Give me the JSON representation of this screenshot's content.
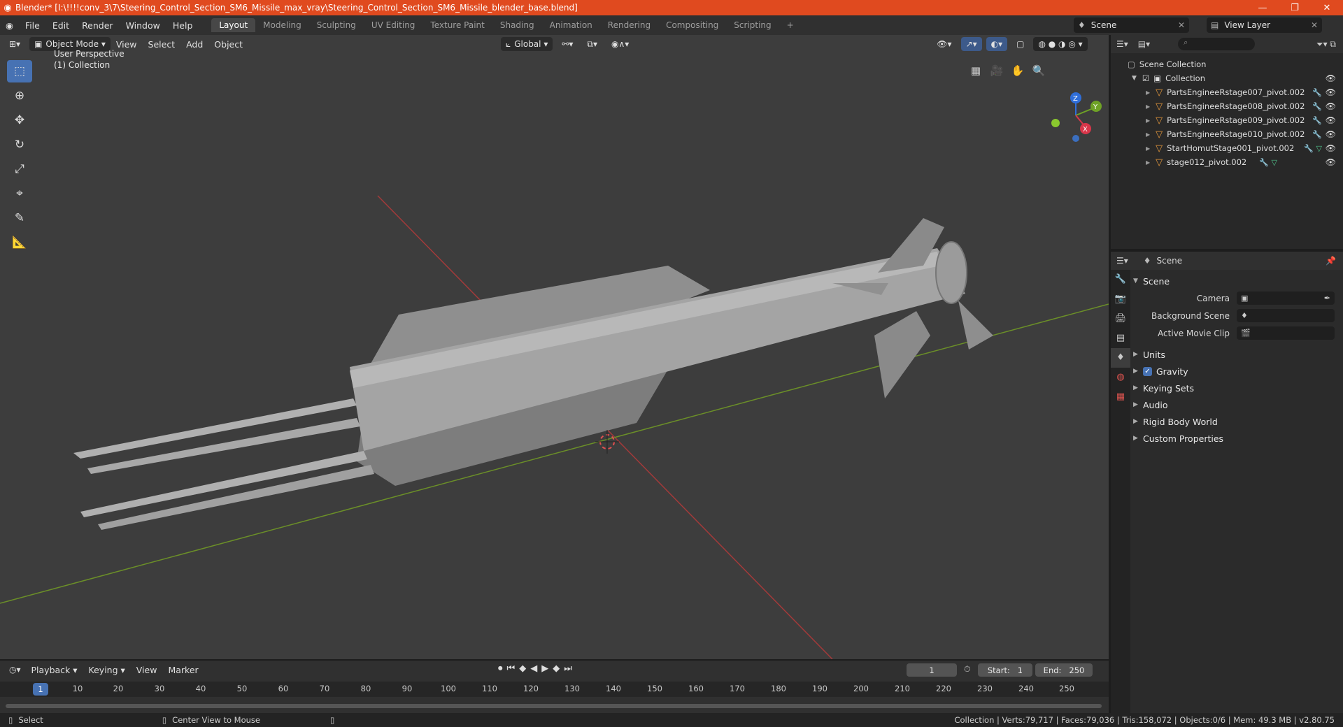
{
  "window": {
    "title": "Blender* [I:\\!!!!conv_3\\7\\Steering_Control_Section_SM6_Missile_max_vray\\Steering_Control_Section_SM6_Missile_blender_base.blend]",
    "minimize": "—",
    "maximize": "❐",
    "close": "✕"
  },
  "menu": [
    "File",
    "Edit",
    "Render",
    "Window",
    "Help"
  ],
  "workspaces": [
    "Layout",
    "Modeling",
    "Sculpting",
    "UV Editing",
    "Texture Paint",
    "Shading",
    "Animation",
    "Rendering",
    "Compositing",
    "Scripting"
  ],
  "active_workspace": "Layout",
  "scene_name": "Scene",
  "view_layer": "View Layer",
  "viewport": {
    "mode": "Object Mode",
    "menus": [
      "View",
      "Select",
      "Add",
      "Object"
    ],
    "transform": "Global",
    "overlay_line1": "User Perspective",
    "overlay_line2": "(1) Collection",
    "gizmo": {
      "x": "X",
      "y": "Y",
      "z": "Z"
    }
  },
  "outliner": {
    "root": "Scene Collection",
    "collection": "Collection",
    "items": [
      "PartsEngineeRstage007_pivot.002",
      "PartsEngineeRstage008_pivot.002",
      "PartsEngineeRstage009_pivot.002",
      "PartsEngineeRstage010_pivot.002",
      "StartHomutStage001_pivot.002",
      "stage012_pivot.002"
    ]
  },
  "properties": {
    "context": "Scene",
    "panel": "Scene",
    "fields": [
      {
        "label": "Camera"
      },
      {
        "label": "Background Scene"
      },
      {
        "label": "Active Movie Clip"
      }
    ],
    "sections": [
      "Units",
      "Gravity",
      "Keying Sets",
      "Audio",
      "Rigid Body World",
      "Custom Properties"
    ]
  },
  "timeline": {
    "menus": [
      "Playback",
      "Keying",
      "View",
      "Marker"
    ],
    "current_frame": "1",
    "start_label": "Start:",
    "start": "1",
    "end_label": "End:",
    "end": "250",
    "ticks": [
      "10",
      "20",
      "30",
      "40",
      "50",
      "60",
      "70",
      "80",
      "90",
      "100",
      "110",
      "120",
      "130",
      "140",
      "150",
      "160",
      "170",
      "180",
      "190",
      "200",
      "210",
      "220",
      "230",
      "240",
      "250"
    ],
    "cursor": "1"
  },
  "status": {
    "select": "Select",
    "center": "Center View to Mouse",
    "stats": "Collection | Verts:79,717 | Faces:79,036 | Tris:158,072 | Objects:0/6 | Mem: 49.3 MB | v2.80.75"
  },
  "colors": {
    "titlebar": "#e04a1f",
    "accent": "#4772b3",
    "viewport_bg": "#3d3d3d"
  }
}
